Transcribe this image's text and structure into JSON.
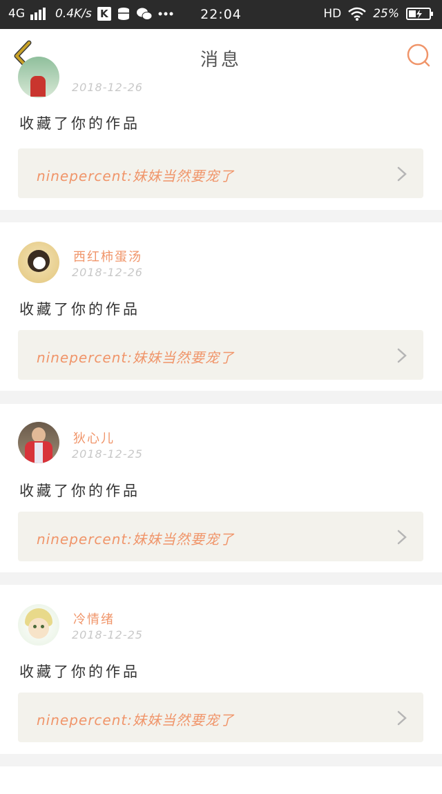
{
  "status_bar": {
    "network": "4G",
    "speed": "0.4K/s",
    "time": "22:04",
    "hd": "HD",
    "battery": "25%"
  },
  "header": {
    "title": "消息"
  },
  "items": [
    {
      "user": "",
      "date": "2018-12-26",
      "action": "收藏了你的作品",
      "quote": "ninepercent:妹妹当然要宠了"
    },
    {
      "user": "西红柿蛋汤",
      "date": "2018-12-26",
      "action": "收藏了你的作品",
      "quote": "ninepercent:妹妹当然要宠了"
    },
    {
      "user": "狄心儿",
      "date": "2018-12-25",
      "action": "收藏了你的作品",
      "quote": "ninepercent:妹妹当然要宠了"
    },
    {
      "user": "冷情绪",
      "date": "2018-12-25",
      "action": "收藏了你的作品",
      "quote": "ninepercent:妹妹当然要宠了"
    }
  ],
  "colors": {
    "accent": "#f0956a",
    "back_arrow": "#c9a227",
    "quote_bg": "#f3f2ec",
    "status_bar_bg": "#2b2b2b"
  },
  "icons": [
    "signal-icon",
    "k-app-icon",
    "storage-icon",
    "wechat-icon",
    "more-icon",
    "wifi-icon",
    "battery-icon",
    "back-arrow-icon",
    "search-icon",
    "chevron-right-icon"
  ]
}
